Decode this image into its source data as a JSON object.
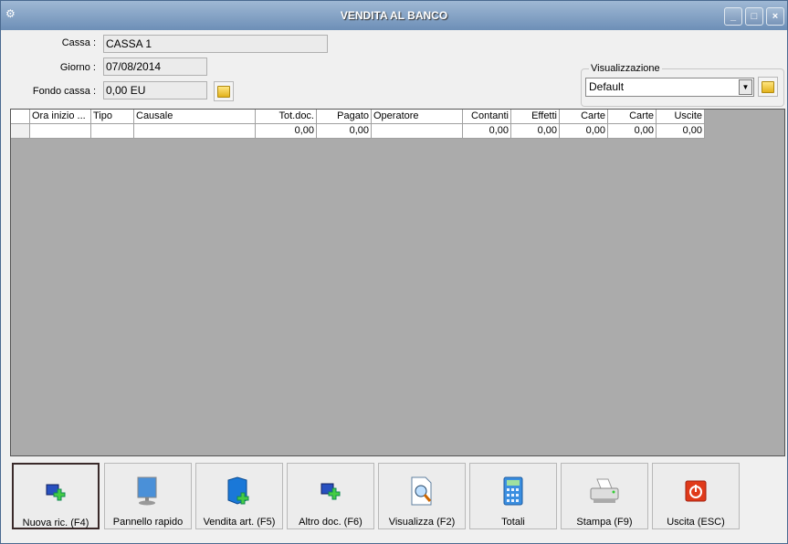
{
  "window": {
    "title": "VENDITA AL BANCO",
    "minimize": "_",
    "maximize": "□",
    "close": "×"
  },
  "form": {
    "cassa_label": "Cassa :",
    "cassa_value": "CASSA 1",
    "giorno_label": "Giorno :",
    "giorno_value": "07/08/2014",
    "fondo_label": "Fondo cassa :",
    "fondo_value": "0,00 EU"
  },
  "visualizzazione": {
    "label": "Visualizzazione",
    "selected": "Default"
  },
  "table": {
    "columns": [
      "Ora inizio ...",
      "Tipo",
      "Causale",
      "Tot.doc.",
      "Pagato",
      "Operatore",
      "Contanti",
      "Effetti",
      "Carte",
      "Carte",
      "Uscite"
    ],
    "rows": [
      [
        "",
        "",
        "",
        "0,00",
        "0,00",
        "",
        "0,00",
        "0,00",
        "0,00",
        "0,00",
        "0,00"
      ]
    ]
  },
  "buttons": [
    {
      "label": "Nuova ric. (F4)",
      "icon": "new-receipt-icon"
    },
    {
      "label": "Pannello rapido",
      "icon": "monitor-icon"
    },
    {
      "label": "Vendita art. (F5)",
      "icon": "box-add-icon"
    },
    {
      "label": "Altro doc. (F6)",
      "icon": "doc-add-icon"
    },
    {
      "label": "Visualizza (F2)",
      "icon": "search-doc-icon"
    },
    {
      "label": "Totali",
      "icon": "calculator-icon"
    },
    {
      "label": "Stampa (F9)",
      "icon": "printer-icon"
    },
    {
      "label": "Uscita (ESC)",
      "icon": "power-icon"
    }
  ]
}
